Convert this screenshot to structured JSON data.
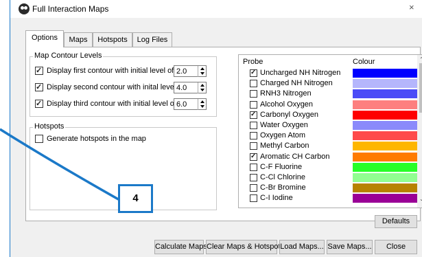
{
  "window": {
    "title": "Full Interaction Maps",
    "close_glyph": "×"
  },
  "tabs": [
    {
      "label": "Options",
      "active": true
    },
    {
      "label": "Maps",
      "active": false
    },
    {
      "label": "Hotspots",
      "active": false
    },
    {
      "label": "Log Files",
      "active": false
    }
  ],
  "map_contour": {
    "legend": "Map Contour Levels",
    "rows": [
      {
        "label": "Display first contour with initial level of",
        "value": "2.0",
        "checked": true
      },
      {
        "label": "Display second contour with inital level of",
        "value": "4.0",
        "checked": true
      },
      {
        "label": "Display third contour with initial level of",
        "value": "6.0",
        "checked": true
      }
    ]
  },
  "hotspots": {
    "legend": "Hotspots",
    "generate_label": "Generate hotspots in the map",
    "checked": false
  },
  "probe_table": {
    "col_probe": "Probe",
    "col_colour": "Colour",
    "rows": [
      {
        "probe": "Uncharged NH Nitrogen",
        "checked": true,
        "colour": "#0000ff"
      },
      {
        "probe": "Charged NH Nitrogen",
        "checked": false,
        "colour": "#b5b6fc"
      },
      {
        "probe": "RNH3 Nitrogen",
        "checked": false,
        "colour": "#4b4cf7"
      },
      {
        "probe": "Alcohol Oxygen",
        "checked": false,
        "colour": "#fd7f7f"
      },
      {
        "probe": "Carbonyl Oxygen",
        "checked": true,
        "colour": "#fe0000"
      },
      {
        "probe": "Water Oxygen",
        "checked": false,
        "colour": "#8a8afb"
      },
      {
        "probe": "Oxygen Atom",
        "checked": false,
        "colour": "#fe4a4a"
      },
      {
        "probe": "Methyl Carbon",
        "checked": false,
        "colour": "#feb600"
      },
      {
        "probe": "Aromatic CH Carbon",
        "checked": true,
        "colour": "#ff7b00"
      },
      {
        "probe": "C-F Fluorine",
        "checked": false,
        "colour": "#28fe28"
      },
      {
        "probe": "C-Cl Chlorine",
        "checked": false,
        "colour": "#91fe91"
      },
      {
        "probe": "C-Br Bromine",
        "checked": false,
        "colour": "#b78200"
      },
      {
        "probe": "C-I Iodine",
        "checked": false,
        "colour": "#9a0096"
      }
    ]
  },
  "buttons": {
    "defaults": "Defaults",
    "calculate": "Calculate Maps",
    "clear": "Clear Maps & Hotspots",
    "load": "Load Maps...",
    "save": "Save Maps...",
    "close": "Close"
  },
  "callout": {
    "number": "4",
    "color": "#1b79c8"
  },
  "accent_color": "#1979ca"
}
